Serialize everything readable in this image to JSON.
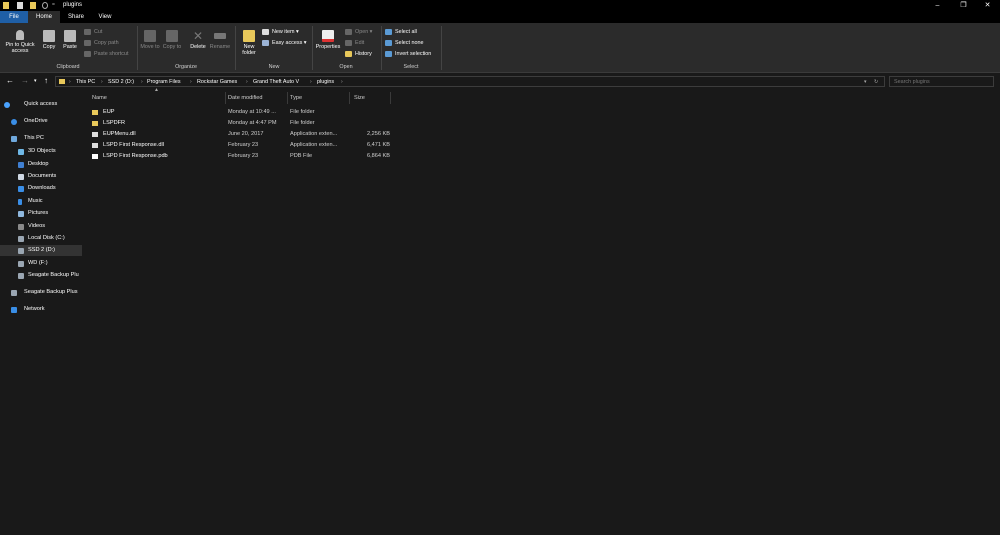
{
  "window": {
    "title": "plugins",
    "min": "–",
    "max": "❐",
    "close": "✕"
  },
  "tabs": {
    "file": "File",
    "home": "Home",
    "share": "Share",
    "view": "View"
  },
  "ribbon": {
    "pin": "Pin to Quick access",
    "copy": "Copy",
    "paste": "Paste",
    "cut": "Cut",
    "copy_path": "Copy path",
    "paste_shortcut": "Paste shortcut",
    "clipboard": "Clipboard",
    "move_to": "Move to",
    "copy_to": "Copy to",
    "delete": "Delete",
    "rename": "Rename",
    "organize": "Organize",
    "new_folder": "New folder",
    "new_item": "New item",
    "easy_access": "Easy access",
    "new": "New",
    "properties": "Properties",
    "open": "Open",
    "edit": "Edit",
    "history": "History",
    "open_grp": "Open",
    "select_all": "Select all",
    "select_none": "Select none",
    "invert": "Invert selection",
    "select_grp": "Select"
  },
  "address": {
    "crumbs": [
      "This PC",
      "SSD 2 (D:)",
      "Program Files",
      "Rockstar Games",
      "Grand Theft Auto V",
      "plugins"
    ]
  },
  "search": {
    "placeholder": "Search plugins"
  },
  "sidebar": {
    "items": [
      "Quick access",
      "OneDrive",
      "This PC",
      "3D Objects",
      "Desktop",
      "Documents",
      "Downloads",
      "Music",
      "Pictures",
      "Videos",
      "Local Disk (C:)",
      "SSD 2 (D:)",
      "WD (F:)",
      "Seagate Backup Plu",
      "Seagate Backup Plus",
      "Network"
    ]
  },
  "columns": {
    "name": "Name",
    "date": "Date modified",
    "type": "Type",
    "size": "Size"
  },
  "files": [
    {
      "name": "EUP",
      "date": "Monday at 10:49 ...",
      "type": "File folder",
      "size": ""
    },
    {
      "name": "LSPDFR",
      "date": "Monday at 4:47 PM",
      "type": "File folder",
      "size": ""
    },
    {
      "name": "EUPMenu.dll",
      "date": "June 20, 2017",
      "type": "Application exten...",
      "size": "2,256 KB"
    },
    {
      "name": "LSPD First Response.dll",
      "date": "February 23",
      "type": "Application exten...",
      "size": "6,471 KB"
    },
    {
      "name": "LSPD First Response.pdb",
      "date": "February 23",
      "type": "PDB File",
      "size": "6,864 KB"
    }
  ]
}
